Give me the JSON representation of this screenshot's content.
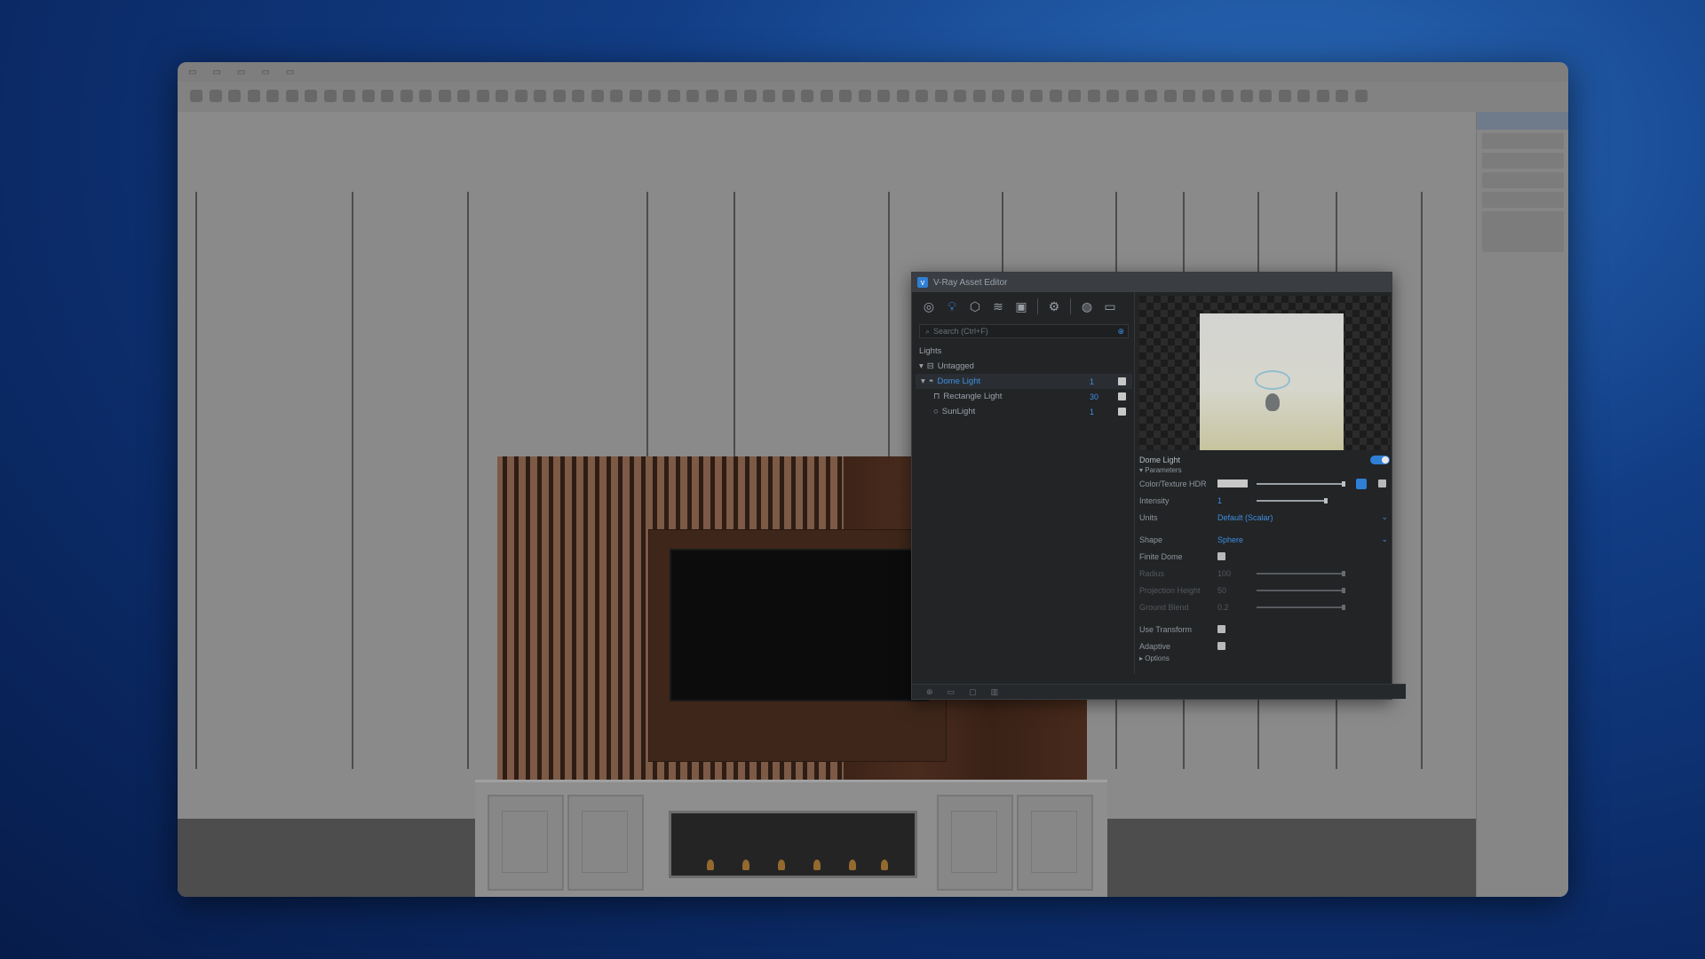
{
  "vray": {
    "title": "V-Ray Asset Editor",
    "search_placeholder": "Search (Ctrl+F)",
    "lights_header": "Lights",
    "tag_group": "Untagged",
    "items": [
      {
        "label": "Dome Light",
        "count": "1"
      },
      {
        "label": "Rectangle Light",
        "count": "30"
      },
      {
        "label": "SunLight",
        "count": "1"
      }
    ],
    "props": {
      "selected_name": "Dome Light",
      "section": "Parameters",
      "color_label": "Color/Texture HDR",
      "intensity_label": "Intensity",
      "intensity_value": "1",
      "units_label": "Units",
      "units_value": "Default (Scalar)",
      "shape_label": "Shape",
      "shape_value": "Sphere",
      "finite_dome_label": "Finite Dome",
      "radius_label": "Radius",
      "radius_value": "100",
      "proj_height_label": "Projection Height",
      "proj_height_value": "50",
      "ground_blend_label": "Ground Blend",
      "ground_blend_value": "0.2",
      "use_transform_label": "Use Transform",
      "adaptive_label": "Adaptive",
      "options_section": "Options"
    }
  }
}
